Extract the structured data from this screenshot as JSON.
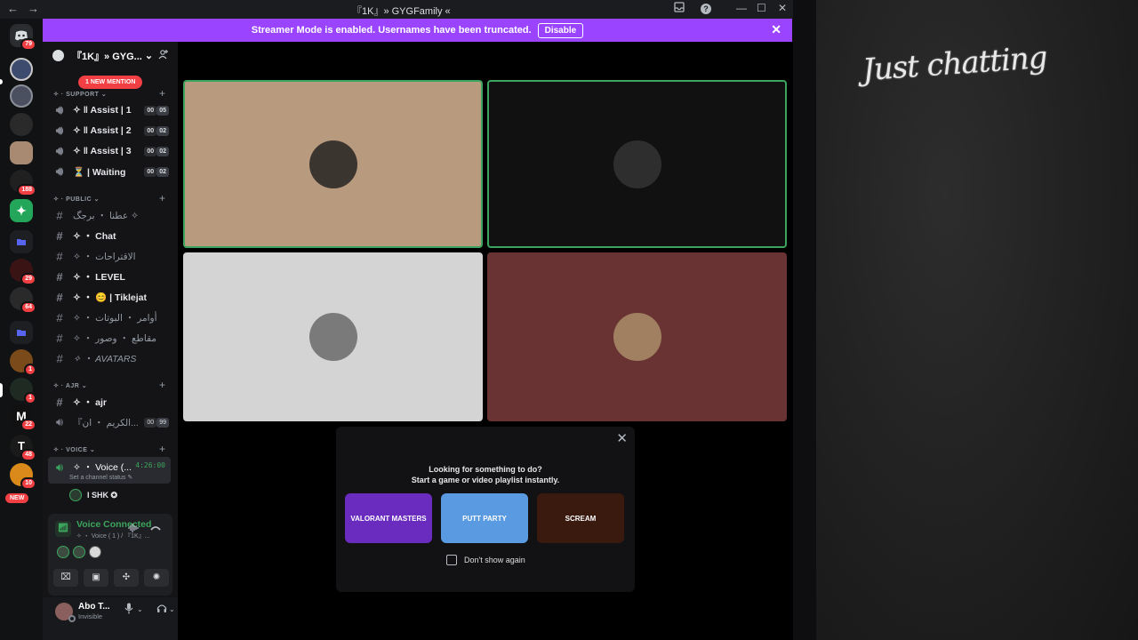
{
  "window": {
    "title": "『1K』» GYGFamily «",
    "back": "←",
    "forward": "→",
    "inbox_icon": "inbox-icon",
    "help": "?",
    "minimize": "—",
    "maximize": "☐",
    "close": "✕"
  },
  "banner": {
    "message": "Streamer Mode is enabled. Usernames have been truncated.",
    "disable_label": "Disable",
    "close": "✕"
  },
  "rail": {
    "badges": [
      "79",
      "188",
      "29",
      "64",
      "1",
      "1",
      "22",
      "48",
      "10"
    ],
    "new_label": "NEW"
  },
  "guild": {
    "name": "『1K』» GYG...",
    "chevron": "⌄",
    "mention_pill": "1 NEW MENTION"
  },
  "categories": {
    "support": "✧ · SUPPORT ⌄",
    "public": "✧ · PUBLIC ⌄",
    "ajr": "✧ · AJR ⌄",
    "voice": "✧ · VOICE ⌄"
  },
  "channels": {
    "support": [
      {
        "name": "✧ ‖ Assist | 1",
        "a": "00",
        "b": "05"
      },
      {
        "name": "✧ ‖ Assist | 2",
        "a": "00",
        "b": "02"
      },
      {
        "name": "✧ ‖ Assist | 3",
        "a": "00",
        "b": "02"
      },
      {
        "name": "⏳ | Waiting",
        "a": "00",
        "b": "02"
      }
    ],
    "public": [
      "عطنا ・ برجگ ✧",
      "✧ ・ Chat",
      "✧ ・ الاقتراحات",
      "✧ ・ LEVEL",
      "✧ ・ 😊 | Tiklejat",
      "✧ ・ أوامر ・ البوتات",
      "✧ ・ مقاطع ・ وصور",
      "✧ ・ AVATARS"
    ],
    "ajr": [
      {
        "name": "✧ ・ ajr"
      },
      {
        "name": "『الكريم ・ ان...",
        "a": "00",
        "b": "99"
      }
    ],
    "voice_channel": "✧ ・ Voice (...",
    "voice_timer": "4:26:00",
    "voice_status": "Set a channel status ✎",
    "member": "I SHK ✪"
  },
  "voice_panel": {
    "status": "Voice Connected",
    "sub": "✧ ・ Voice ( 1 ) / 『1K』...",
    "signal_icon": "signal-icon",
    "wave_icon": "soundwave-icon",
    "disconnect_icon": "disconnect-icon",
    "buttons": [
      "camera-off-icon",
      "screen-share-icon",
      "activities-icon",
      "soundboard-icon"
    ]
  },
  "user": {
    "name": "Abo T...",
    "status": "Invisible"
  },
  "stage": {
    "tiles": [
      {
        "bg": "#b89a7e",
        "avatar": "#3b3530",
        "speaking": true
      },
      {
        "bg": "#111111",
        "avatar": "#2e2e2e",
        "speaking": true
      },
      {
        "bg": "#d4d4d4",
        "avatar": "#7a7a7a",
        "speaking": false
      },
      {
        "bg": "#6a3333",
        "avatar": "#a08060",
        "speaking": false
      }
    ]
  },
  "popup": {
    "line1": "Looking for something to do?",
    "line2": "Start a game or video playlist instantly.",
    "cards": [
      {
        "label": "VALORANT MASTERS",
        "bg": "#6a2bbf"
      },
      {
        "label": "PUTT PARTY",
        "bg": "#5a9ae0"
      },
      {
        "label": "SCREAM",
        "bg": "#3a1a0f"
      }
    ],
    "checkbox_label": "Don't show again",
    "close": "✕"
  },
  "side": {
    "text": "Just chatting"
  }
}
